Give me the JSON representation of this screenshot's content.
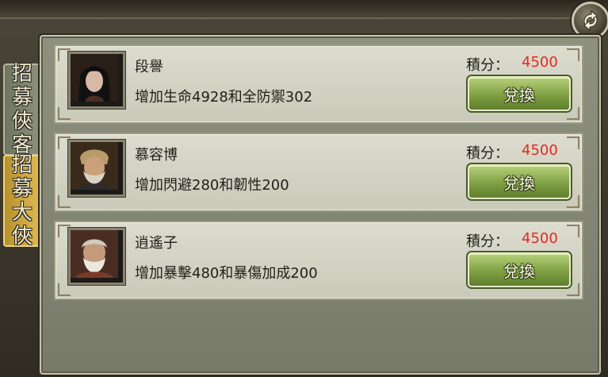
{
  "tabs": [
    {
      "label_chars": [
        "招",
        "募",
        "俠",
        "客"
      ],
      "active": false
    },
    {
      "label_chars": [
        "招",
        "募",
        "大",
        "俠"
      ],
      "active": true
    }
  ],
  "score_label": "積分：",
  "exchange_label": "兌換",
  "heroes": [
    {
      "name": "段譽",
      "description": "增加生命4928和全防禦302",
      "score": "4500"
    },
    {
      "name": "慕容博",
      "description": "增加閃避280和韌性200",
      "score": "4500"
    },
    {
      "name": "逍遙子",
      "description": "增加暴擊480和暴傷加成200",
      "score": "4500"
    }
  ],
  "refresh_icon": "refresh-icon",
  "colors": {
    "score": "#e12a22",
    "button": "#7fa043",
    "active_tab": "#d2ab42"
  }
}
